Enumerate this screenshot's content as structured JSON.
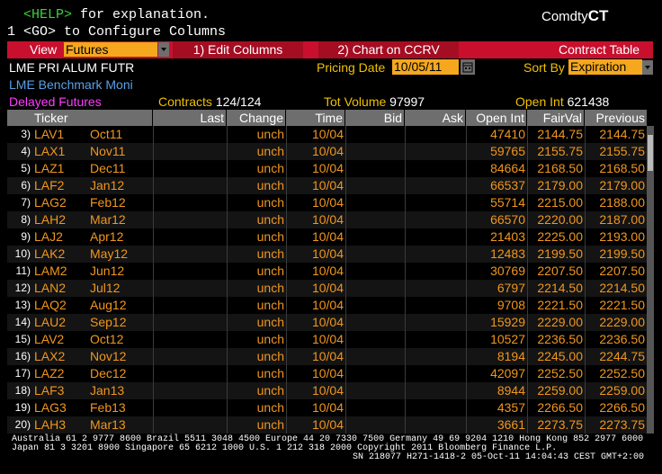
{
  "header": {
    "help_key": "<HELP>",
    "help_text": " for explanation.",
    "config_line": "1 <GO> to Configure Columns",
    "screen_prefix": "Comdty",
    "screen_code": "CT"
  },
  "toolbar": {
    "view_label": "View",
    "view_value": "Futures",
    "edit_columns": "1) Edit Columns",
    "chart_ccrv": "2) Chart on CCRV",
    "contract_table": "Contract Table"
  },
  "info": {
    "security_name": "LME PRI ALUM FUTR",
    "pricing_date_label": "Pricing Date",
    "pricing_date_value": "10/05/11",
    "sort_by_label": "Sort By",
    "sort_by_value": "Expiration",
    "benchmark": "LME Benchmark Moni",
    "delayed": "Delayed Futures",
    "contracts_label": "Contracts",
    "contracts_value": "124/124",
    "tot_volume_label": "Tot Volume",
    "tot_volume_value": "97997",
    "open_int_label": "Open Int",
    "open_int_value": "621438"
  },
  "table": {
    "columns": [
      "Ticker",
      "Last",
      "Change",
      "Time",
      "Bid",
      "Ask",
      "Open Int",
      "FairVal",
      "Previous"
    ],
    "rows": [
      {
        "num": "3)",
        "ticker": "LAV1",
        "month": "Oct11",
        "change": "unch",
        "time": "10/04",
        "open_int": "47410",
        "fairval": "2144.75",
        "previous": "2144.75"
      },
      {
        "num": "4)",
        "ticker": "LAX1",
        "month": "Nov11",
        "change": "unch",
        "time": "10/04",
        "open_int": "59765",
        "fairval": "2155.75",
        "previous": "2155.75"
      },
      {
        "num": "5)",
        "ticker": "LAZ1",
        "month": "Dec11",
        "change": "unch",
        "time": "10/04",
        "open_int": "84664",
        "fairval": "2168.50",
        "previous": "2168.50"
      },
      {
        "num": "6)",
        "ticker": "LAF2",
        "month": "Jan12",
        "change": "unch",
        "time": "10/04",
        "open_int": "66537",
        "fairval": "2179.00",
        "previous": "2179.00"
      },
      {
        "num": "7)",
        "ticker": "LAG2",
        "month": "Feb12",
        "change": "unch",
        "time": "10/04",
        "open_int": "55714",
        "fairval": "2215.00",
        "previous": "2188.00"
      },
      {
        "num": "8)",
        "ticker": "LAH2",
        "month": "Mar12",
        "change": "unch",
        "time": "10/04",
        "open_int": "66570",
        "fairval": "2220.00",
        "previous": "2187.00"
      },
      {
        "num": "9)",
        "ticker": "LAJ2",
        "month": "Apr12",
        "change": "unch",
        "time": "10/04",
        "open_int": "21403",
        "fairval": "2225.00",
        "previous": "2193.00"
      },
      {
        "num": "10)",
        "ticker": "LAK2",
        "month": "May12",
        "change": "unch",
        "time": "10/04",
        "open_int": "12483",
        "fairval": "2199.50",
        "previous": "2199.50"
      },
      {
        "num": "11)",
        "ticker": "LAM2",
        "month": "Jun12",
        "change": "unch",
        "time": "10/04",
        "open_int": "30769",
        "fairval": "2207.50",
        "previous": "2207.50"
      },
      {
        "num": "12)",
        "ticker": "LAN2",
        "month": "Jul12",
        "change": "unch",
        "time": "10/04",
        "open_int": "6797",
        "fairval": "2214.50",
        "previous": "2214.50"
      },
      {
        "num": "13)",
        "ticker": "LAQ2",
        "month": "Aug12",
        "change": "unch",
        "time": "10/04",
        "open_int": "9708",
        "fairval": "2221.50",
        "previous": "2221.50"
      },
      {
        "num": "14)",
        "ticker": "LAU2",
        "month": "Sep12",
        "change": "unch",
        "time": "10/04",
        "open_int": "15929",
        "fairval": "2229.00",
        "previous": "2229.00"
      },
      {
        "num": "15)",
        "ticker": "LAV2",
        "month": "Oct12",
        "change": "unch",
        "time": "10/04",
        "open_int": "10527",
        "fairval": "2236.50",
        "previous": "2236.50"
      },
      {
        "num": "16)",
        "ticker": "LAX2",
        "month": "Nov12",
        "change": "unch",
        "time": "10/04",
        "open_int": "8194",
        "fairval": "2245.00",
        "previous": "2244.75"
      },
      {
        "num": "17)",
        "ticker": "LAZ2",
        "month": "Dec12",
        "change": "unch",
        "time": "10/04",
        "open_int": "42097",
        "fairval": "2252.50",
        "previous": "2252.50"
      },
      {
        "num": "18)",
        "ticker": "LAF3",
        "month": "Jan13",
        "change": "unch",
        "time": "10/04",
        "open_int": "8944",
        "fairval": "2259.00",
        "previous": "2259.00"
      },
      {
        "num": "19)",
        "ticker": "LAG3",
        "month": "Feb13",
        "change": "unch",
        "time": "10/04",
        "open_int": "4357",
        "fairval": "2266.50",
        "previous": "2266.50"
      },
      {
        "num": "20)",
        "ticker": "LAH3",
        "month": "Mar13",
        "change": "unch",
        "time": "10/04",
        "open_int": "3661",
        "fairval": "2273.75",
        "previous": "2273.75"
      }
    ]
  },
  "footer": {
    "line1": "Australia 61 2 9777 8600 Brazil 5511 3048 4500 Europe 44 20 7330 7500 Germany 49 69 9204 1210 Hong Kong 852 2977 6000",
    "line2": "Japan 81 3 3201 8900        Singapore 65 6212 1000        U.S. 1 212 318 2000        Copyright 2011 Bloomberg Finance L.P.",
    "line3": "SN 218077 H271-1418-2 05-Oct-11 14:04:43 CEST GMT+2:00"
  },
  "colors": {
    "accent_red": "#c8102e",
    "field_orange": "#f5a81e",
    "value_orange": "#f0961e",
    "label_yellow": "#f0c000",
    "help_green": "#3cd23c"
  }
}
